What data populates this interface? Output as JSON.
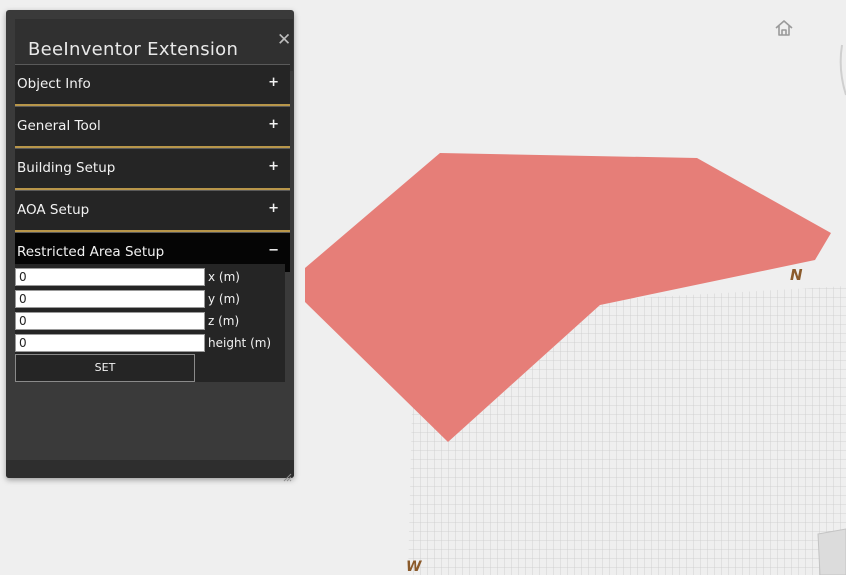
{
  "extension": {
    "title": "BeeInventor Extension",
    "close_icon": "close-icon",
    "sections": [
      {
        "label": "Object Info",
        "toggle": "+",
        "expanded": false
      },
      {
        "label": "General Tool",
        "toggle": "+",
        "expanded": false
      },
      {
        "label": "Building Setup",
        "toggle": "+",
        "expanded": false
      },
      {
        "label": "AOA Setup",
        "toggle": "+",
        "expanded": false
      },
      {
        "label": "Restricted Area Setup",
        "toggle": "−",
        "expanded": true
      }
    ],
    "restricted_area_form": {
      "fields": [
        {
          "value": "0",
          "unit_label": "x (m)"
        },
        {
          "value": "0",
          "unit_label": "y (m)"
        },
        {
          "value": "0",
          "unit_label": "z (m)"
        },
        {
          "value": "0",
          "unit_label": "height (m)"
        }
      ],
      "set_label": "SET"
    }
  },
  "viewer": {
    "home_icon": "home-icon",
    "compass_north": "N",
    "compass_west": "W",
    "restricted_area_color": "#e67e78",
    "grid_color": "#c9c9c9"
  }
}
